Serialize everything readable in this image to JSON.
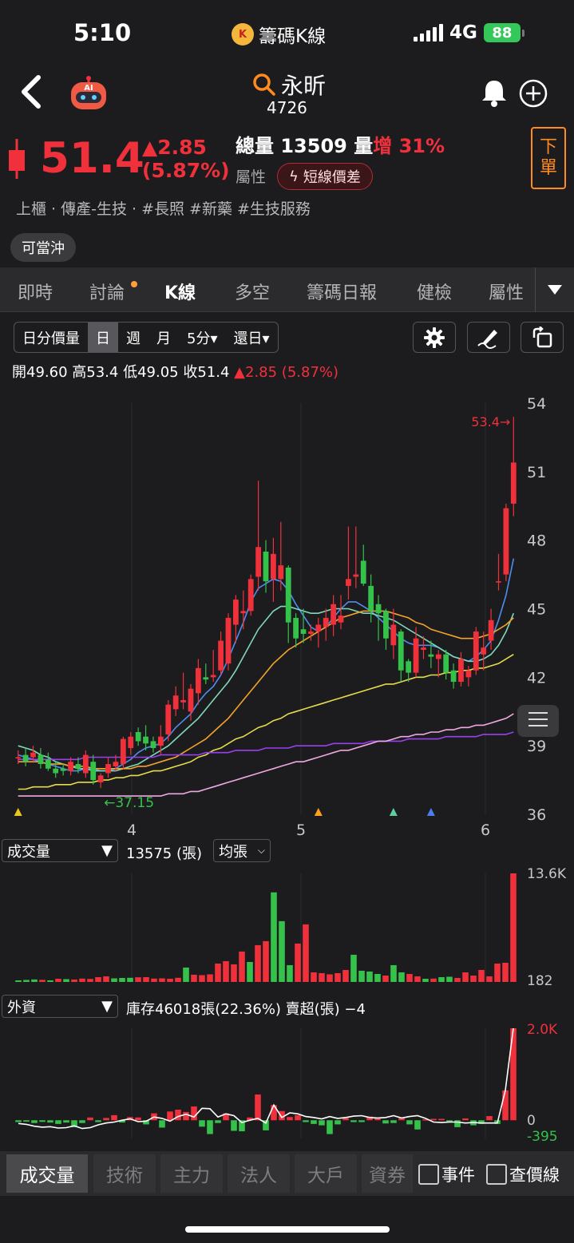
{
  "status": {
    "time": "5:10",
    "app_name": "籌碼K線",
    "app_logo_text": "K",
    "network": "4G",
    "battery": "88"
  },
  "header": {
    "ai_badge": "AI",
    "stock_name": "永昕",
    "stock_code": "4726",
    "price": "51.4",
    "change": "▲2.85",
    "change_pct": "(5.87%)",
    "volume_label": "總量",
    "volume_value": "13509",
    "volume_unit": "量",
    "volume_inc_label": "增",
    "volume_inc_pct": "31%",
    "attr_label": "屬性",
    "attr_badge": "短線價差",
    "order_button_top": "下",
    "order_button_bottom": "單",
    "industry": "上櫃 · 傳產-生技 · #長照 #新藥 #生技服務",
    "day_trade": "可當沖"
  },
  "tabs": [
    "即時",
    "討論",
    "K線",
    "多空",
    "籌碼日報",
    "健檢",
    "屬性"
  ],
  "active_tab": "K線",
  "chart_toolbar": {
    "items": [
      "日分價量",
      "日",
      "週",
      "月",
      "5分▾",
      "還日▾"
    ],
    "selected": "日"
  },
  "ohlc": {
    "open_label": "開",
    "open": "49.60",
    "high_label": "高",
    "high": "53.4",
    "low_label": "低",
    "low": "49.05",
    "close_label": "收",
    "close": "51.4",
    "change": "▲2.85 (5.87%)"
  },
  "price_chart": {
    "y_ticks": [
      "54",
      "51",
      "48",
      "45",
      "42",
      "39",
      "36"
    ],
    "x_ticks": [
      "4",
      "5",
      "6"
    ],
    "high_marker": "53.4→",
    "low_marker": "←37.15"
  },
  "volume_panel": {
    "select": "成交量",
    "value_text": "13575 (張)",
    "toggle": "均張",
    "ymax_label": "13.6K",
    "ymin_label": "182"
  },
  "foreign_panel": {
    "select": "外資",
    "info_text": "庫存46018張(22.36%)  賣超(張) −4",
    "ymax_label": "2.0K",
    "zero_label": "0",
    "ymin_label": "-395"
  },
  "chart_data": [
    {
      "type": "candlestick",
      "ylim": [
        36,
        54
      ],
      "candles": [
        [
          38.5,
          38.8,
          38.2,
          38.5
        ],
        [
          38.6,
          38.9,
          38.1,
          38.3
        ],
        [
          38.5,
          39.0,
          38.3,
          38.7
        ],
        [
          38.6,
          38.9,
          38.0,
          38.2
        ],
        [
          38.4,
          38.7,
          37.9,
          38.0
        ],
        [
          38.0,
          38.3,
          37.6,
          37.8
        ],
        [
          38.0,
          38.2,
          37.7,
          37.9
        ],
        [
          37.9,
          38.5,
          37.7,
          38.3
        ],
        [
          38.2,
          38.5,
          37.8,
          38.0
        ],
        [
          37.8,
          38.8,
          37.6,
          38.6
        ],
        [
          38.3,
          38.6,
          37.3,
          37.5
        ],
        [
          37.4,
          37.8,
          37.15,
          37.7
        ],
        [
          37.8,
          38.5,
          37.6,
          38.2
        ],
        [
          38.1,
          38.6,
          37.9,
          38.3
        ],
        [
          38.2,
          39.4,
          38.0,
          39.3
        ],
        [
          38.9,
          39.6,
          38.6,
          39.4
        ],
        [
          39.6,
          39.8,
          39.0,
          39.2
        ],
        [
          39.4,
          39.9,
          38.8,
          39.1
        ],
        [
          39.2,
          39.4,
          38.7,
          38.9
        ],
        [
          39.0,
          39.9,
          38.6,
          39.4
        ],
        [
          39.5,
          41.0,
          39.2,
          40.8
        ],
        [
          40.6,
          41.6,
          40.3,
          41.2
        ],
        [
          40.9,
          42.2,
          40.6,
          41.0
        ],
        [
          40.5,
          41.7,
          40.1,
          41.5
        ],
        [
          41.3,
          42.8,
          40.8,
          42.4
        ],
        [
          42.0,
          42.6,
          41.7,
          41.9
        ],
        [
          42.0,
          43.2,
          41.8,
          42.1
        ],
        [
          42.3,
          44.0,
          42.1,
          43.6
        ],
        [
          42.6,
          44.8,
          42.3,
          44.6
        ],
        [
          44.3,
          45.6,
          43.5,
          45.4
        ],
        [
          44.8,
          45.8,
          44.1,
          44.9
        ],
        [
          44.9,
          46.5,
          44.7,
          46.3
        ],
        [
          46.4,
          50.6,
          45.8,
          47.7
        ],
        [
          47.5,
          48.0,
          45.7,
          46.2
        ],
        [
          46.3,
          48.1,
          45.3,
          47.4
        ],
        [
          46.3,
          48.8,
          45.8,
          46.9
        ],
        [
          46.8,
          46.9,
          43.5,
          44.4
        ],
        [
          44.6,
          44.8,
          43.3,
          43.7
        ],
        [
          44.1,
          45.0,
          43.5,
          43.9
        ],
        [
          43.9,
          44.3,
          43.6,
          44.0
        ],
        [
          44.0,
          44.6,
          43.3,
          44.3
        ],
        [
          44.2,
          45.0,
          43.6,
          44.6
        ],
        [
          44.3,
          45.6,
          43.8,
          45.2
        ],
        [
          44.4,
          45.6,
          44.1,
          44.7
        ],
        [
          46.0,
          48.6,
          45.4,
          46.3
        ],
        [
          46.4,
          48.6,
          45.9,
          46.5
        ],
        [
          47.1,
          47.8,
          46.0,
          46.1
        ],
        [
          46.0,
          46.5,
          44.4,
          44.9
        ],
        [
          45.2,
          45.6,
          43.6,
          44.8
        ],
        [
          44.9,
          45.0,
          43.2,
          43.7
        ],
        [
          43.4,
          45.0,
          42.8,
          44.3
        ],
        [
          44.0,
          44.1,
          41.8,
          42.3
        ],
        [
          42.7,
          42.8,
          41.8,
          42.2
        ],
        [
          42.2,
          44.2,
          42.0,
          43.7
        ],
        [
          43.2,
          43.8,
          42.8,
          43.3
        ],
        [
          43.0,
          43.6,
          42.4,
          42.9
        ],
        [
          42.8,
          43.2,
          42.0,
          43.0
        ],
        [
          43.0,
          43.2,
          41.9,
          42.2
        ],
        [
          42.3,
          42.6,
          41.5,
          41.8
        ],
        [
          41.8,
          43.1,
          41.6,
          42.8
        ],
        [
          42.0,
          42.5,
          41.6,
          42.3
        ],
        [
          42.3,
          44.2,
          42.1,
          44.0
        ],
        [
          43.0,
          44.0,
          42.3,
          43.3
        ],
        [
          43.6,
          45.0,
          43.2,
          44.5
        ],
        [
          46.2,
          47.4,
          45.8,
          46.2
        ],
        [
          46.5,
          49.6,
          46.2,
          49.4
        ],
        [
          49.6,
          53.4,
          49.05,
          51.4
        ]
      ],
      "ma_lines": [
        {
          "color": "#4d8ef0",
          "values": [
            38.6,
            38.5,
            38.4,
            38.3,
            38.2,
            38.1,
            38.0,
            37.9,
            37.9,
            38.0,
            38.0,
            37.9,
            37.9,
            38.0,
            38.2,
            38.4,
            38.7,
            38.9,
            39.0,
            39.1,
            39.4,
            39.8,
            40.1,
            40.4,
            40.9,
            41.3,
            41.6,
            42.1,
            42.8,
            43.6,
            44.4,
            45.3,
            45.9,
            46.1,
            46.3,
            46.2,
            45.8,
            45.2,
            44.7,
            44.2,
            44.0,
            44.2,
            44.6,
            45.0,
            45.3,
            45.3,
            45.1,
            44.9,
            44.6,
            44.3,
            44.0,
            43.7,
            43.5,
            43.4,
            43.4,
            43.4,
            43.3,
            43.1,
            42.9,
            42.8,
            42.7,
            42.9,
            43.2,
            43.6,
            44.5,
            45.6,
            47.2
          ]
        },
        {
          "color": "#7fd8b8",
          "values": [
            39.0,
            38.9,
            38.8,
            38.6,
            38.5,
            38.3,
            38.2,
            38.1,
            38.0,
            38.0,
            37.9,
            37.9,
            37.9,
            37.9,
            38.0,
            38.1,
            38.2,
            38.4,
            38.6,
            38.8,
            39.0,
            39.3,
            39.6,
            39.9,
            40.2,
            40.6,
            41.0,
            41.4,
            41.8,
            42.3,
            42.9,
            43.5,
            44.1,
            44.5,
            44.9,
            45.1,
            45.1,
            45.0,
            44.9,
            44.8,
            44.8,
            44.9,
            45.0,
            45.0,
            45.0,
            44.9,
            44.8,
            44.8,
            44.7,
            44.6,
            44.5,
            44.3,
            44.1,
            43.9,
            43.7,
            43.5,
            43.3,
            43.1,
            42.9,
            42.8,
            42.7,
            42.7,
            42.8,
            43.0,
            43.4,
            44.0,
            44.8
          ]
        },
        {
          "color": "#f3a32a",
          "values": [
            38.3,
            38.3,
            38.3,
            38.3,
            38.2,
            38.2,
            38.2,
            38.1,
            38.1,
            38.1,
            38.0,
            38.0,
            38.0,
            38.0,
            38.0,
            38.0,
            38.1,
            38.1,
            38.2,
            38.3,
            38.4,
            38.5,
            38.7,
            38.9,
            39.1,
            39.3,
            39.6,
            39.9,
            40.2,
            40.6,
            41.0,
            41.4,
            41.8,
            42.2,
            42.6,
            42.9,
            43.2,
            43.4,
            43.6,
            43.8,
            44.0,
            44.2,
            44.4,
            44.6,
            44.7,
            44.8,
            44.9,
            44.9,
            44.9,
            44.9,
            44.8,
            44.7,
            44.6,
            44.4,
            44.3,
            44.1,
            44.0,
            43.9,
            43.8,
            43.7,
            43.7,
            43.7,
            43.8,
            43.9,
            44.1,
            44.3,
            44.6
          ]
        },
        {
          "color": "#e4dc4a",
          "values": [
            37.1,
            37.1,
            37.2,
            37.2,
            37.2,
            37.3,
            37.3,
            37.3,
            37.4,
            37.4,
            37.4,
            37.5,
            37.5,
            37.6,
            37.6,
            37.7,
            37.7,
            37.8,
            37.9,
            37.9,
            38.0,
            38.1,
            38.2,
            38.3,
            38.5,
            38.6,
            38.8,
            38.9,
            39.1,
            39.3,
            39.4,
            39.6,
            39.8,
            39.9,
            40.1,
            40.2,
            40.4,
            40.5,
            40.6,
            40.7,
            40.8,
            40.9,
            41.0,
            41.1,
            41.2,
            41.3,
            41.4,
            41.5,
            41.6,
            41.7,
            41.7,
            41.8,
            41.9,
            42.0,
            42.0,
            42.1,
            42.1,
            42.2,
            42.2,
            42.3,
            42.3,
            42.4,
            42.4,
            42.5,
            42.6,
            42.8,
            43.0
          ]
        },
        {
          "color": "#9a3ff0",
          "values": [
            38.4,
            38.4,
            38.4,
            38.4,
            38.4,
            38.4,
            38.4,
            38.4,
            38.4,
            38.5,
            38.5,
            38.5,
            38.5,
            38.5,
            38.5,
            38.5,
            38.5,
            38.5,
            38.5,
            38.6,
            38.6,
            38.6,
            38.6,
            38.6,
            38.6,
            38.7,
            38.7,
            38.7,
            38.7,
            38.8,
            38.8,
            38.8,
            38.8,
            38.9,
            38.9,
            38.9,
            38.9,
            39.0,
            39.0,
            39.0,
            39.0,
            39.0,
            39.1,
            39.1,
            39.1,
            39.1,
            39.1,
            39.2,
            39.2,
            39.2,
            39.2,
            39.2,
            39.3,
            39.3,
            39.3,
            39.3,
            39.3,
            39.4,
            39.4,
            39.4,
            39.4,
            39.4,
            39.5,
            39.5,
            39.5,
            39.5,
            39.6
          ]
        },
        {
          "color": "#f0a8e0",
          "values": [
            36.8,
            36.8,
            36.8,
            36.8,
            36.8,
            36.8,
            36.8,
            36.8,
            36.8,
            36.8,
            36.8,
            36.8,
            36.8,
            36.8,
            36.8,
            36.8,
            36.8,
            36.8,
            36.8,
            36.8,
            36.9,
            36.9,
            36.9,
            37.0,
            37.0,
            37.1,
            37.2,
            37.3,
            37.4,
            37.5,
            37.6,
            37.7,
            37.8,
            37.9,
            38.0,
            38.1,
            38.2,
            38.3,
            38.3,
            38.4,
            38.5,
            38.6,
            38.7,
            38.8,
            38.8,
            38.9,
            39.0,
            39.1,
            39.2,
            39.2,
            39.3,
            39.4,
            39.4,
            39.5,
            39.5,
            39.6,
            39.6,
            39.7,
            39.7,
            39.8,
            39.8,
            39.9,
            39.9,
            40.0,
            40.1,
            40.2,
            40.4
          ]
        }
      ],
      "markers": [
        {
          "index": 0,
          "color": "#e8c820"
        },
        {
          "index": 40,
          "color": "#ff9f1a"
        },
        {
          "index": 50,
          "color": "#5fcf9f"
        },
        {
          "index": 55,
          "color": "#4d7ef0"
        }
      ]
    },
    {
      "type": "bar",
      "title": "成交量",
      "ylim": [
        0,
        13575
      ],
      "values": [
        182,
        250,
        310,
        260,
        200,
        400,
        350,
        300,
        420,
        380,
        600,
        700,
        450,
        500,
        520,
        580,
        600,
        420,
        450,
        400,
        520,
        1800,
        900,
        850,
        950,
        2300,
        2600,
        2200,
        3800,
        2500,
        4600,
        5100,
        11200,
        7600,
        2100,
        4800,
        7200,
        1200,
        1100,
        950,
        1100,
        1500,
        3400,
        1400,
        1300,
        1000,
        800,
        2100,
        1200,
        1000,
        700,
        400,
        420,
        600,
        650,
        500,
        1200,
        800,
        1500,
        700,
        2300,
        2400,
        13575
      ],
      "colors": "up=red,down=green"
    },
    {
      "type": "bar",
      "title": "外資",
      "ylim": [
        -395,
        2000
      ],
      "values": [
        -40,
        -30,
        -60,
        -35,
        -50,
        -80,
        -50,
        -150,
        -60,
        60,
        -40,
        50,
        110,
        -50,
        70,
        60,
        -90,
        150,
        -160,
        190,
        230,
        180,
        300,
        -140,
        -300,
        -60,
        150,
        -230,
        -240,
        60,
        560,
        -220,
        330,
        200,
        70,
        110,
        -40,
        -80,
        -110,
        -300,
        -90,
        50,
        -40,
        -40,
        80,
        40,
        -70,
        -60,
        50,
        -90,
        -200,
        20,
        30,
        30,
        -30,
        -150,
        40,
        -110,
        -80,
        90,
        -80,
        650,
        2000
      ],
      "line": [
        -70,
        -90,
        -130,
        -150,
        -140,
        -170,
        -160,
        -120,
        -180,
        -160,
        -100,
        -60,
        -40,
        0,
        30,
        -30,
        -20,
        70,
        40,
        -20,
        80,
        130,
        70,
        260,
        250,
        70,
        140,
        100,
        -50,
        0,
        40,
        -60,
        330,
        60,
        160,
        140,
        80,
        60,
        30,
        80,
        40,
        60,
        90,
        100,
        60,
        50,
        60,
        100,
        50,
        80,
        100,
        40,
        -40,
        -50,
        -40,
        -40,
        -60,
        -50,
        -60,
        -60,
        -60,
        650,
        2000
      ]
    }
  ],
  "bottom_tabs": [
    "成交量",
    "技術",
    "主力",
    "法人",
    "大戶",
    "資券"
  ],
  "bottom_active": "成交量",
  "checkboxes": [
    "事件",
    "查價線"
  ],
  "colors": {
    "up": "#f0313c",
    "down": "#35c24a",
    "bg": "#1c1c1e",
    "accent": "#ff8a1f"
  }
}
